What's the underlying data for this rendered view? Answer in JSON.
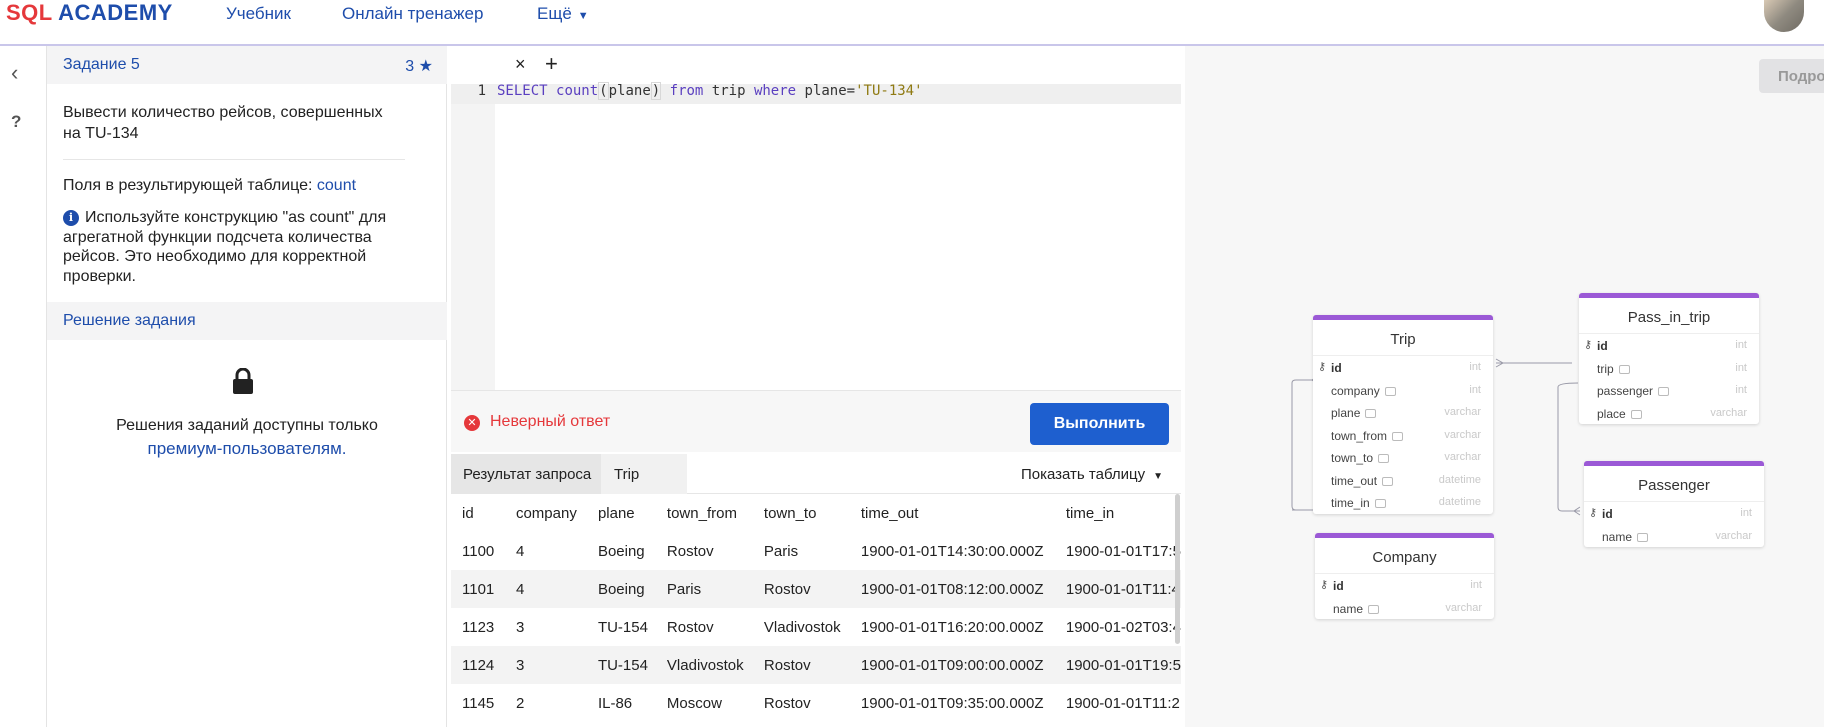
{
  "header": {
    "logo_part1": "SQL",
    "logo_part2": "ACADEMY",
    "nav": [
      "Учебник",
      "Онлайн тренажер",
      "Ещё"
    ]
  },
  "rail": {
    "back_icon": "‹",
    "help_icon": "?"
  },
  "task": {
    "title": "Задание 5",
    "score": "3",
    "description": "Вывести количество рейсов, совершенных на TU-134",
    "fields_label": "Поля в результирующей таблице:",
    "fields_value": "count",
    "hint": "Используйте конструкцию \"as count\" для агрегатной функции подсчета количества рейсов. Это необходимо для корректной проверки.",
    "solution_label": "Решение задания",
    "premium_text": "Решения заданий доступны только",
    "premium_link": "премиум-пользователям."
  },
  "editor": {
    "tab_close": "×",
    "tab_add": "+",
    "line_number": "1",
    "code_tokens": [
      {
        "t": "SELECT",
        "c": "kw"
      },
      {
        "t": " "
      },
      {
        "t": "count",
        "c": "kw"
      },
      {
        "t": "(",
        "c": "paren"
      },
      {
        "t": "plane"
      },
      {
        "t": ")",
        "c": "paren"
      },
      {
        "t": " "
      },
      {
        "t": "from",
        "c": "kw"
      },
      {
        "t": " trip "
      },
      {
        "t": "where",
        "c": "kw"
      },
      {
        "t": " plane="
      },
      {
        "t": "'TU-134'",
        "c": "str"
      }
    ]
  },
  "status": {
    "error_text": "Неверный ответ",
    "run_button": "Выполнить"
  },
  "results": {
    "tabs": [
      "Результат запроса",
      "Trip"
    ],
    "show_table": "Показать таблицу",
    "columns": [
      "id",
      "company",
      "plane",
      "town_from",
      "town_to",
      "time_out",
      "time_in"
    ],
    "rows": [
      [
        "1100",
        "4",
        "Boeing",
        "Rostov",
        "Paris",
        "1900-01-01T14:30:00.000Z",
        "1900-01-01T17:5"
      ],
      [
        "1101",
        "4",
        "Boeing",
        "Paris",
        "Rostov",
        "1900-01-01T08:12:00.000Z",
        "1900-01-01T11:4"
      ],
      [
        "1123",
        "3",
        "TU-154",
        "Rostov",
        "Vladivostok",
        "1900-01-01T16:20:00.000Z",
        "1900-01-02T03:4"
      ],
      [
        "1124",
        "3",
        "TU-154",
        "Vladivostok",
        "Rostov",
        "1900-01-01T09:00:00.000Z",
        "1900-01-01T19:5"
      ],
      [
        "1145",
        "2",
        "IL-86",
        "Moscow",
        "Rostov",
        "1900-01-01T09:35:00.000Z",
        "1900-01-01T11:2"
      ]
    ]
  },
  "schema": {
    "more_button": "Подро",
    "entities": {
      "trip": {
        "name": "Trip",
        "fields": [
          {
            "name": "id",
            "type": "int",
            "pk": true
          },
          {
            "name": "company",
            "type": "int"
          },
          {
            "name": "plane",
            "type": "varchar"
          },
          {
            "name": "town_from",
            "type": "varchar"
          },
          {
            "name": "town_to",
            "type": "varchar"
          },
          {
            "name": "time_out",
            "type": "datetime"
          },
          {
            "name": "time_in",
            "type": "datetime"
          }
        ]
      },
      "pass_in_trip": {
        "name": "Pass_in_trip",
        "fields": [
          {
            "name": "id",
            "type": "int",
            "pk": true
          },
          {
            "name": "trip",
            "type": "int"
          },
          {
            "name": "passenger",
            "type": "int"
          },
          {
            "name": "place",
            "type": "varchar"
          }
        ]
      },
      "passenger": {
        "name": "Passenger",
        "fields": [
          {
            "name": "id",
            "type": "int",
            "pk": true
          },
          {
            "name": "name",
            "type": "varchar"
          }
        ]
      },
      "company": {
        "name": "Company",
        "fields": [
          {
            "name": "id",
            "type": "int",
            "pk": true
          },
          {
            "name": "name",
            "type": "varchar"
          }
        ]
      }
    }
  }
}
